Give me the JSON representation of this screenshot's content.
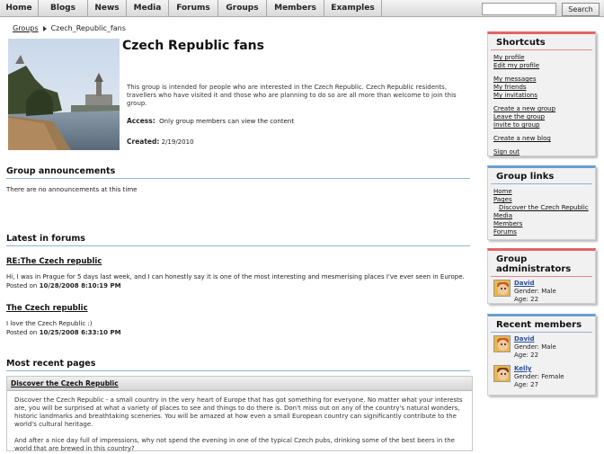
{
  "nav": {
    "items": [
      "Home",
      "Blogs",
      "News",
      "Media",
      "Forums",
      "Groups",
      "Members",
      "Examples"
    ]
  },
  "search": {
    "button": "Search",
    "value": ""
  },
  "breadcrumb": {
    "link": "Groups",
    "current": "Czech_Republic_fans"
  },
  "group": {
    "title": "Czech Republic fans",
    "description": "This group is intended for people who are interested in the Czech Republic. Czech Republic residents, travellers who have visited it and those who are planning to do so are all more than welcome to join this group.",
    "access_label": "Access:",
    "access_value": "Only group members can view the content",
    "created_label": "Created:",
    "created_value": "2/19/2010"
  },
  "announcements": {
    "heading": "Group announcements",
    "text": "There are no announcements at this time"
  },
  "forums": {
    "heading": "Latest in forums",
    "posts": [
      {
        "title": "RE:The Czech republic",
        "body": "Hi, I was in Prague for 5 days last week, and I can honestly say it is one of the most interesting and mesmerising places I've ever seen in Europe.",
        "posted_label": "Posted on",
        "posted_date": "10/28/2008 8:10:19 PM"
      },
      {
        "title": "The Czech republic",
        "body": "I love the Czech Republic :)",
        "posted_label": "Posted on",
        "posted_date": "10/25/2008 6:33:10 PM"
      }
    ]
  },
  "pages": {
    "heading": "Most recent pages",
    "item_title": "Discover the Czech Republic",
    "para1": "Discover the Czech Republic - a small country in the very heart of Europe that has got something for everyone. No matter what your interests are, you will be surprised at what a variety of places to see and things to do there is. Don't miss out on any of the country's natural wonders, historic landmarks and breathtaking sceneries. You will be amazed at how even a small European country can significantly contribute to the world's cultural heritage.",
    "para2": "And after a nice day full of impressions, why not spend the evening in one of the typical Czech pubs, drinking some of the best beers in the world that are brewed in this country?"
  },
  "shortcuts": {
    "heading": "Shortcuts",
    "groups": [
      [
        "My profile",
        "Edit my profile"
      ],
      [
        "My messages",
        "My friends",
        "My invitations"
      ],
      [
        "Create a new group",
        "Leave the group",
        "Invite to group"
      ],
      [
        "Create a new blog"
      ],
      [
        "Sign out"
      ]
    ]
  },
  "group_links": {
    "heading": "Group links",
    "items": [
      "Home",
      "Pages",
      "Discover the Czech Republic",
      "Media",
      "Members",
      "Forums"
    ]
  },
  "admins": {
    "heading": "Group administrators",
    "users": [
      {
        "name": "David",
        "gender": "Gender: Male",
        "age": "Age: 22"
      }
    ]
  },
  "recent_members": {
    "heading": "Recent members",
    "users": [
      {
        "name": "David",
        "gender": "Gender: Male",
        "age": "Age: 22"
      },
      {
        "name": "Kelly",
        "gender": "Gender: Female",
        "age": "Age: 27"
      }
    ]
  },
  "colors": {
    "accent_red": "#e06666",
    "accent_blue": "#6b9fd0"
  }
}
